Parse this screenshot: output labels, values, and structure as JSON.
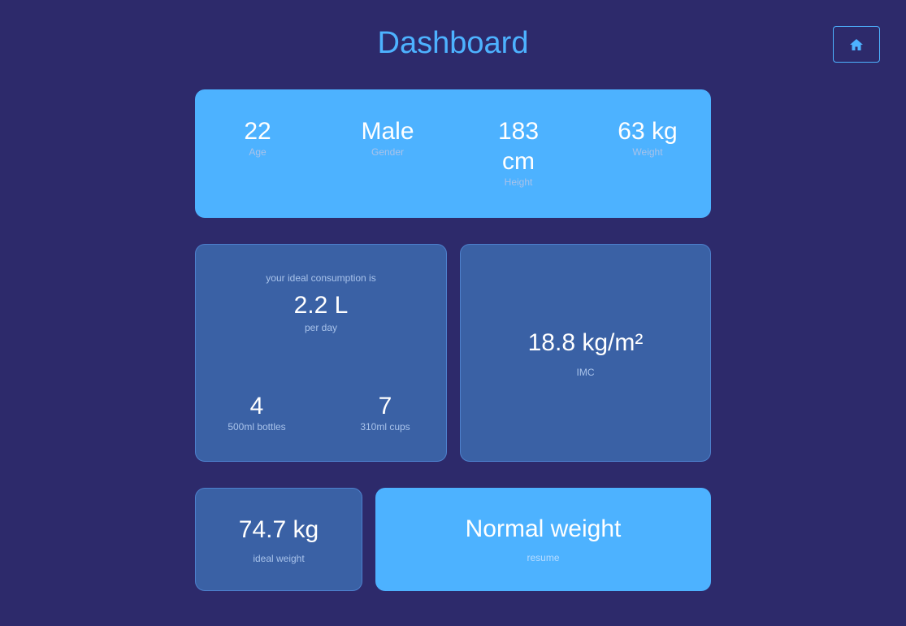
{
  "header": {
    "title": "Dashboard",
    "home_icon": "home-icon"
  },
  "profile": {
    "age": {
      "value": "22",
      "label": "Age"
    },
    "gender": {
      "value": "Male",
      "label": "Gender"
    },
    "height": {
      "value": "183 cm",
      "label": "Height"
    },
    "weight": {
      "value": "63 kg",
      "label": "Weight"
    }
  },
  "water": {
    "intro": "your ideal consumption is",
    "amount": "2.2 L",
    "period": "per day",
    "bottles": {
      "value": "4",
      "label": "500ml bottles"
    },
    "cups": {
      "value": "7",
      "label": "310ml cups"
    }
  },
  "imc": {
    "value": "18.8 kg/m²",
    "label": "IMC"
  },
  "ideal_weight": {
    "value": "74.7 kg",
    "label": "ideal weight"
  },
  "resume": {
    "value": "Normal weight",
    "label": "resume"
  },
  "colors": {
    "background": "#2d2a6b",
    "accent": "#4db2ff",
    "card_dark": "#3a61a5",
    "text": "#ffffff"
  }
}
